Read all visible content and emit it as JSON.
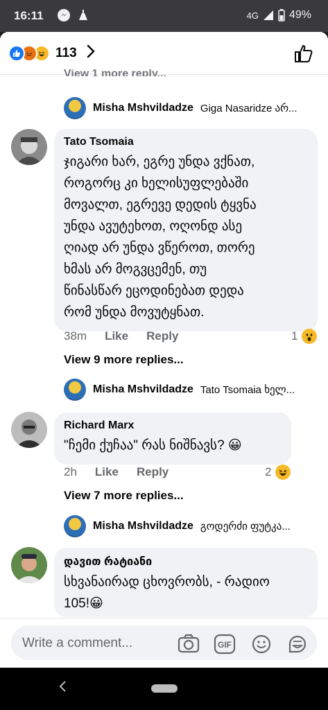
{
  "status": {
    "time": "16:11",
    "network": "4G",
    "battery": "49%"
  },
  "header": {
    "reaction_count": "113",
    "reactions": [
      "like-icon",
      "angry-icon",
      "haha-icon"
    ]
  },
  "cutoff_text": "View 1 more reply...",
  "thread": [
    {
      "reply_preview": {
        "name": "Misha Mshvildadze",
        "snippet": "Giga Nasaridze არ..."
      },
      "comment": {
        "author": "Tato Tsomaia",
        "lines": [
          "ჯიგარი ხარ, ეგრე უნდა ვქნათ,",
          "როგორც კი ხელისუფლებაში",
          "მოვალთ, ეგრევე დედის ტყვნა",
          "უნდა ავუტეხოთ, ოღონდ ასე",
          "ღიად არ უნდა ვწეროთ, თორე",
          "ხმას არ მოგვცემენ, თუ",
          "წინასწარ ეცოდინებათ დედა",
          "რომ უნდა მოვუტყნათ."
        ],
        "time": "38m",
        "like": "Like",
        "reply": "Reply",
        "reaction_count": "1",
        "reaction_icon": "wow-icon",
        "more_replies": "View 9 more replies..."
      }
    },
    {
      "reply_preview": {
        "name": "Misha Mshvildadze",
        "snippet": "Tato Tsomaia ხელ..."
      },
      "comment": {
        "author": "Richard Marx",
        "lines": [
          "\"ჩემი ქუჩაა\" რას ნიშნავს? 😀"
        ],
        "time": "2h",
        "like": "Like",
        "reply": "Reply",
        "reaction_count": "2",
        "reaction_icon": "haha-icon",
        "more_replies": "View 7 more replies..."
      }
    },
    {
      "reply_preview": {
        "name": "Misha Mshvildadze",
        "snippet": "გოდერძი ფუტკა..."
      },
      "comment": {
        "author": "დავით რატიანი",
        "lines": [
          "სხვანაირად ცხოვრობს, - რადიო",
          "105!😀"
        ]
      }
    }
  ],
  "composer": {
    "placeholder": "Write a comment...",
    "tools": [
      "camera-icon",
      "gif-icon",
      "emoji-icon",
      "sticker-icon"
    ]
  }
}
